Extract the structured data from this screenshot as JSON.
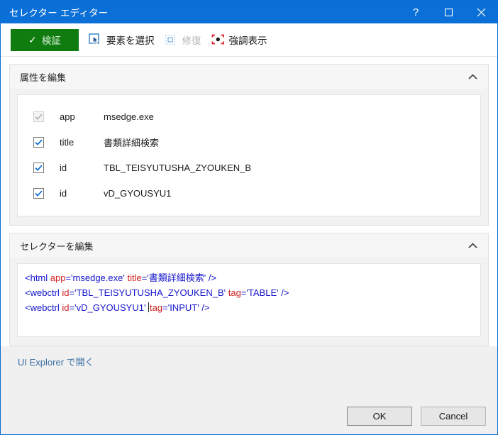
{
  "window": {
    "title": "セレクター エディター",
    "controls": [
      {
        "name": "help-button",
        "glyph": "?"
      },
      {
        "name": "maximize-button",
        "glyph": "□"
      },
      {
        "name": "close-button",
        "glyph": "✕"
      }
    ]
  },
  "toolbar": {
    "validate_label": "検証",
    "validate_color": "#107c10",
    "items": [
      {
        "label": "要素を選択",
        "icon": "select-element-icon",
        "disabled": false
      },
      {
        "label": "修復",
        "icon": "repair-icon",
        "disabled": true
      },
      {
        "label": "強調表示",
        "icon": "highlight-icon",
        "disabled": false
      }
    ]
  },
  "attributes_panel": {
    "title": "属性を編集",
    "collapse_icon": "chevron-up-icon",
    "rows": [
      {
        "checked": true,
        "enabled": false,
        "name": "app",
        "value": "msedge.exe"
      },
      {
        "checked": true,
        "enabled": true,
        "name": "title",
        "value": "書類詳細検索"
      },
      {
        "checked": true,
        "enabled": true,
        "name": "id",
        "value": "TBL_TEISYUTUSHA_ZYOUKEN_B"
      },
      {
        "checked": true,
        "enabled": true,
        "name": "id",
        "value": "vD_GYOUSYU1"
      }
    ]
  },
  "selector_panel": {
    "title": "セレクターを編集",
    "collapse_icon": "chevron-up-icon",
    "lines": [
      {
        "segments": [
          {
            "type": "tag",
            "text": "<html "
          },
          {
            "type": "attr",
            "text": "app"
          },
          {
            "type": "val",
            "text": "='msedge.exe' "
          },
          {
            "type": "attr",
            "text": "title"
          },
          {
            "type": "val",
            "text": "='書類詳細検索' />"
          }
        ]
      },
      {
        "segments": [
          {
            "type": "tag",
            "text": "<webctrl "
          },
          {
            "type": "attr",
            "text": "id"
          },
          {
            "type": "val",
            "text": "='TBL_TEISYUTUSHA_ZYOUKEN_B' "
          },
          {
            "type": "attr",
            "text": "tag"
          },
          {
            "type": "val",
            "text": "='TABLE' />"
          }
        ]
      },
      {
        "segments": [
          {
            "type": "tag",
            "text": "<webctrl "
          },
          {
            "type": "attr",
            "text": "id"
          },
          {
            "type": "val",
            "text": "='vD_GYOUSYU1' "
          },
          {
            "type": "caret",
            "text": ""
          },
          {
            "type": "attr",
            "text": "tag"
          },
          {
            "type": "val",
            "text": "='INPUT' />"
          }
        ]
      }
    ]
  },
  "footer": {
    "explorer_link": "UI Explorer で開く",
    "ok_label": "OK",
    "cancel_label": "Cancel"
  }
}
